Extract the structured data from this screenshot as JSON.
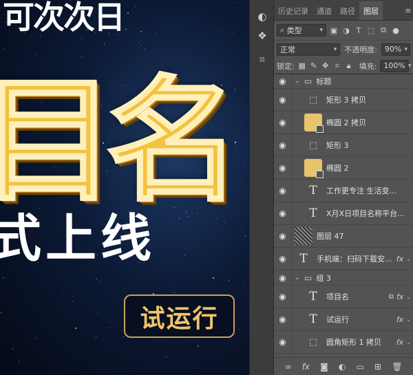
{
  "canvas": {
    "top_text": "可次次日",
    "big_text": "目名",
    "sub_text": "式上线",
    "trial_label": "试运行"
  },
  "tabs": [
    "历史记录",
    "通道",
    "路径",
    "图层"
  ],
  "filter": {
    "kind_label": "类型"
  },
  "blend": {
    "mode": "正常",
    "opacity_label": "不透明度:",
    "opacity_value": "90%"
  },
  "lock": {
    "lock_label": "锁定:",
    "fill_label": "填充:",
    "fill_value": "100%"
  },
  "layers": [
    {
      "name": "标题",
      "kind": "group"
    },
    {
      "name": "矩形 3 拷贝",
      "kind": "shape"
    },
    {
      "name": "椭圆 2 拷贝",
      "kind": "ellipse"
    },
    {
      "name": "矩形 3",
      "kind": "shape"
    },
    {
      "name": "椭圆 2",
      "kind": "ellipse"
    },
    {
      "name": "工作更专注  生活变...",
      "kind": "text"
    },
    {
      "name": "X月X日项目名称平台...",
      "kind": "text"
    },
    {
      "name": "图层 47",
      "kind": "pixel"
    },
    {
      "name": "手机端：扫码下载安...",
      "kind": "text",
      "fx": "fx"
    },
    {
      "name": "组 3",
      "kind": "group"
    },
    {
      "name": "项目名",
      "kind": "text",
      "fx": "fx"
    },
    {
      "name": "试运行",
      "kind": "text",
      "fx": "fx"
    },
    {
      "name": "圆角矩形 1 拷贝",
      "kind": "shape",
      "fx": "fx"
    }
  ],
  "icons": {
    "tool_1": "adjust-icon",
    "tool_2": "3d-icon",
    "tool_3": "crop-icon",
    "footer": [
      "link-icon",
      "fx-icon",
      "mask-icon",
      "adjustment-icon",
      "folder-icon",
      "new-layer-icon",
      "trash-icon"
    ]
  },
  "colors": {
    "panel_bg": "#535353",
    "tab_bg": "#424242",
    "gold": "#f2c240"
  }
}
